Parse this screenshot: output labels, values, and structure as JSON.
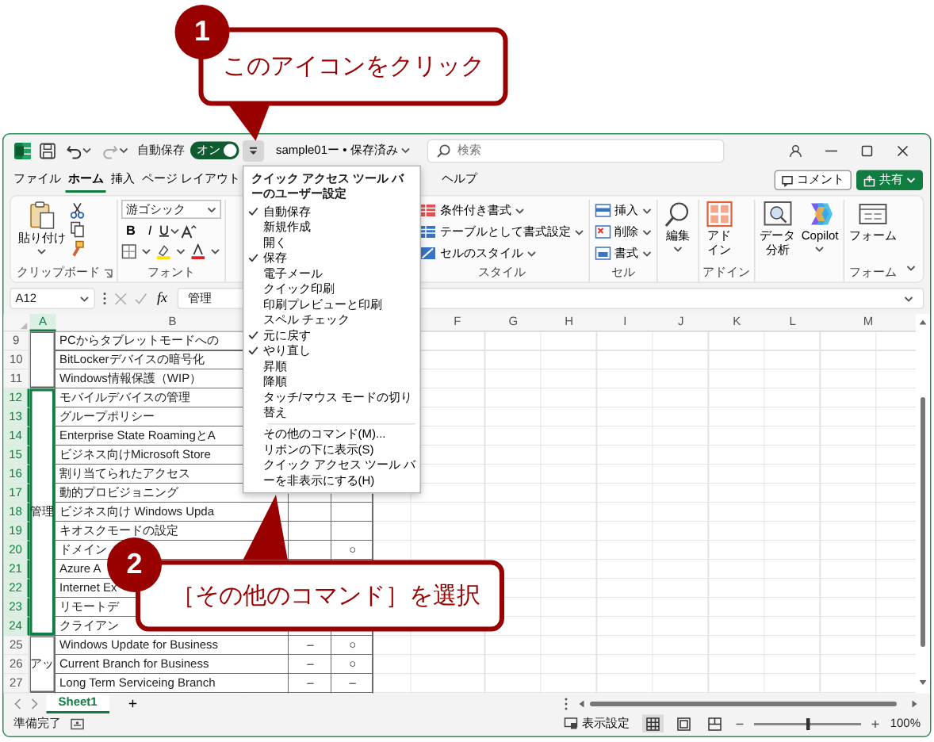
{
  "callouts": [
    {
      "number": "1",
      "text": "このアイコンをクリック"
    },
    {
      "number": "2",
      "text": "［その他のコマンド］を選択"
    }
  ],
  "title_bar": {
    "autosave_label": "自動保存",
    "autosave": {
      "label": "オン",
      "on": true
    },
    "file_name": "sample01ー • 保存済み",
    "search": {
      "placeholder": "検索"
    }
  },
  "quick_access_menu": {
    "open": true,
    "title": "クイック アクセス ツール バーのユーザー設定",
    "items": [
      {
        "label": "自動保存",
        "checked": true
      },
      {
        "label": "新規作成",
        "checked": false
      },
      {
        "label": "開く",
        "checked": false
      },
      {
        "label": "保存",
        "checked": true
      },
      {
        "label": "電子メール",
        "checked": false
      },
      {
        "label": "クイック印刷",
        "checked": false
      },
      {
        "label": "印刷プレビューと印刷",
        "checked": false
      },
      {
        "label": "スペル チェック",
        "checked": false
      },
      {
        "label": "元に戻す",
        "checked": true
      },
      {
        "label": "やり直し",
        "checked": true
      },
      {
        "label": "昇順",
        "checked": false
      },
      {
        "label": "降順",
        "checked": false
      },
      {
        "label": "タッチ/マウス モードの切り替え",
        "checked": false
      }
    ],
    "commands": [
      "その他のコマンド(M)...",
      "リボンの下に表示(S)",
      "クイック アクセス ツール バーを非表示にする(H)"
    ]
  },
  "ribbon_tabs": [
    {
      "label": "ファイル",
      "selected": false
    },
    {
      "label": "ホーム",
      "selected": true
    },
    {
      "label": "挿入",
      "selected": false
    },
    {
      "label": "ページ レイアウト",
      "selected": false
    },
    {
      "label": "ヘルプ",
      "selected": false
    }
  ],
  "ribbon_actions": [
    {
      "label": "コメント",
      "kind": "comment"
    },
    {
      "label": "共有",
      "kind": "share"
    }
  ],
  "ribbon_groups": [
    {
      "kind": "clipboard",
      "label": "クリップボード",
      "items": [
        {
          "label": "貼り付け",
          "menu": true
        }
      ]
    },
    {
      "kind": "font",
      "label": "フォント",
      "font_name": "游ゴシック",
      "items": [
        {
          "label": "B",
          "menu": false
        },
        {
          "label": "I",
          "menu": false
        },
        {
          "label": "U",
          "menu": true
        }
      ]
    },
    {
      "kind": "stacked",
      "label": "スタイル",
      "items": [
        {
          "label": "条件付き書式",
          "menu": true
        },
        {
          "label": "テーブルとして書式設定",
          "menu": true
        },
        {
          "label": "セルのスタイル",
          "menu": true
        }
      ]
    },
    {
      "kind": "stacked",
      "label": "セル",
      "items": [
        {
          "label": "挿入",
          "menu": true
        },
        {
          "label": "削除",
          "menu": true
        },
        {
          "label": "書式",
          "menu": true
        }
      ]
    },
    {
      "kind": "large",
      "items": [
        {
          "label": "編集",
          "menu": true,
          "wrap": false
        }
      ]
    },
    {
      "kind": "large",
      "label": "アドイン",
      "items": [
        {
          "label": "アドイン",
          "menu": false,
          "wrap": true
        }
      ]
    },
    {
      "kind": "large",
      "items": [
        {
          "label": "データ分析",
          "menu": false,
          "wrap": true
        },
        {
          "label": "Copilot",
          "menu": true,
          "wrap": false
        }
      ]
    },
    {
      "kind": "large",
      "label": "フォーム",
      "items": [
        {
          "label": "フォーム",
          "menu": false,
          "wrap": false
        }
      ]
    }
  ],
  "formula_bar": {
    "name_box": "A12",
    "function_label": "fx",
    "formula": "管理"
  },
  "column_headers": [
    "A",
    "B",
    "F",
    "G",
    "H",
    "I",
    "J",
    "K",
    "L",
    "M"
  ],
  "row_groups": [
    {
      "selected": false,
      "rows": [
        {
          "number": "9",
          "column_b": "PCからタブレットモードへの"
        },
        {
          "number": "10",
          "column_b": "BitLockerデバイスの暗号化"
        },
        {
          "number": "11",
          "column_b": "Windows情報保護（WIP）"
        }
      ]
    },
    {
      "label": "管理",
      "selected": true,
      "rows": [
        {
          "number": "12",
          "column_b": "モバイルデバイスの管理"
        },
        {
          "number": "13",
          "column_b": "グループポリシー"
        },
        {
          "number": "14",
          "column_b": "Enterprise State RoamingとA"
        },
        {
          "number": "15",
          "column_b": "ビジネス向けMicrosoft Store"
        },
        {
          "number": "16",
          "column_b": "割り当てられたアクセス"
        },
        {
          "number": "17",
          "column_b": "動的プロビジョニング"
        },
        {
          "number": "18",
          "column_b": "ビジネス向け Windows Upda"
        },
        {
          "number": "19",
          "column_b": "キオスクモードの設定"
        },
        {
          "number": "20",
          "column_b": "ドメイン",
          "column_d": "○"
        },
        {
          "number": "21",
          "column_b": "Azure A"
        },
        {
          "number": "22",
          "column_b": "Internet Ex"
        },
        {
          "number": "23",
          "column_b": "リモートデ"
        },
        {
          "number": "24",
          "column_b": "クライアン"
        }
      ]
    },
    {
      "label": "アッ",
      "selected": false,
      "rows": [
        {
          "number": "25",
          "column_b": "Windows Update for Business",
          "column_c": "–",
          "column_d": "○"
        },
        {
          "number": "26",
          "column_b": "Current Branch for Business",
          "column_c": "–",
          "column_d": "○"
        },
        {
          "number": "27",
          "column_b": "Long Term Serviceing Branch",
          "column_c": "–",
          "column_d": "–"
        }
      ]
    }
  ],
  "sheet_tabs": [
    {
      "label": "Sheet1",
      "selected": true
    }
  ],
  "add_sheet": "+",
  "status_bar": {
    "status": "準備完了",
    "display_settings": "表示設定",
    "zoom": {
      "level": 0.5
    },
    "zoom_reading": "100%"
  }
}
